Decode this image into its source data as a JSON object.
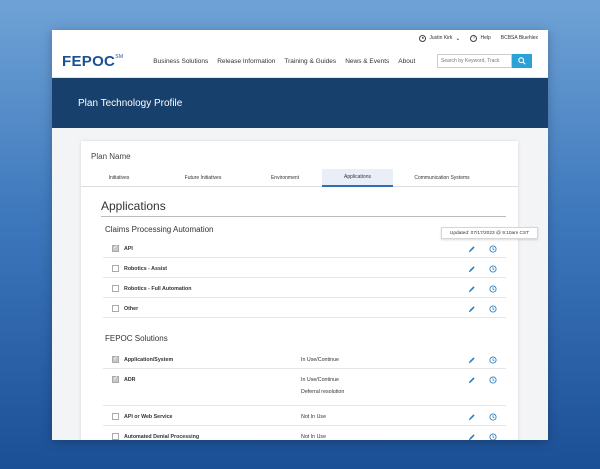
{
  "utility": {
    "user": "Justin Kirk",
    "help": "Help",
    "org": "BCBSA Bluehlex"
  },
  "nav": {
    "logo": "FEPOC",
    "logo_mark": "SM",
    "items": [
      "Business Solutions",
      "Release Information",
      "Training & Guides",
      "News & Events",
      "About"
    ],
    "search_placeholder": "Search by Keyword, Track"
  },
  "hero": {
    "title": "Plan Technology Profile"
  },
  "card": {
    "plan_name": "Plan Name",
    "tabs": [
      "Initiatives",
      "Future Initiatives",
      "Environment",
      "Applications",
      "Communication Systems"
    ],
    "active_tab": "Applications",
    "section_title": "Applications",
    "tooltip": "Updated: 07/17/2023 @ 9:10am CST",
    "groups": [
      {
        "title": "Claims Processing Automation",
        "rows": [
          {
            "label": "API",
            "checked": true,
            "status": "",
            "note": ""
          },
          {
            "label": "Robotics - Assist",
            "checked": false,
            "status": "",
            "note": ""
          },
          {
            "label": "Robotics - Full Automation",
            "checked": false,
            "status": "",
            "note": ""
          },
          {
            "label": "Other",
            "checked": false,
            "status": "",
            "note": ""
          }
        ]
      },
      {
        "title": "FEPOC Solutions",
        "rows": [
          {
            "label": "Application/System",
            "checked": true,
            "status": "In Use/Continue",
            "note": ""
          },
          {
            "label": "ADR",
            "checked": true,
            "status": "In Use/Continue",
            "note": "Deferral resolution"
          },
          {
            "label": "API or Web Service",
            "checked": false,
            "status": "Not In Use",
            "note": ""
          },
          {
            "label": "Automated Denial Processing",
            "checked": false,
            "status": "Not In Use",
            "note": ""
          }
        ]
      }
    ]
  },
  "colors": {
    "brand": "#1b4f96",
    "hero_bg": "#17406c",
    "accent": "#2aa2d6",
    "icon_blue": "#2a7fc4"
  },
  "icons": {
    "edit": "pencil-icon",
    "history": "clock-icon",
    "search": "search-icon",
    "user": "user-icon",
    "help": "help-icon"
  }
}
